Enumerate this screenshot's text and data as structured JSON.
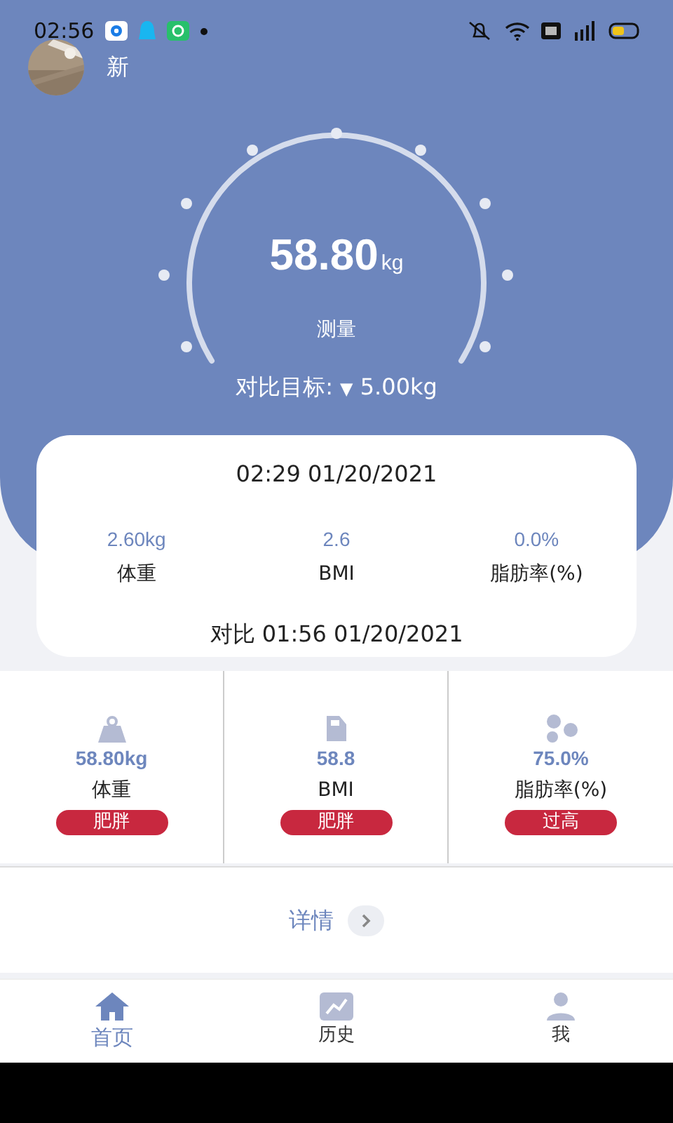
{
  "status_bar": {
    "time": "02:56"
  },
  "profile": {
    "name": "新"
  },
  "gauge": {
    "value": "58.80",
    "unit": "kg",
    "action": "测量"
  },
  "target": {
    "label": "对比目标:",
    "arrow": "▼",
    "value": "5.00kg"
  },
  "comparison": {
    "time": "02:29 01/20/2021",
    "metrics": [
      {
        "value": "2.60kg",
        "label": "体重"
      },
      {
        "value": "2.6",
        "label": "BMI"
      },
      {
        "value": "0.0%",
        "label": "脂肪率(%)"
      }
    ],
    "footer": "对比 01:56 01/20/2021"
  },
  "metrics": [
    {
      "kind": "weight",
      "value": "58.80kg",
      "label": "体重",
      "status": "肥胖"
    },
    {
      "kind": "bmi",
      "value": "58.8",
      "label": "BMI",
      "status": "肥胖"
    },
    {
      "kind": "fat",
      "value": "75.0%",
      "label": "脂肪率(%)",
      "status": "过高"
    }
  ],
  "details": {
    "label": "详情"
  },
  "nav": [
    {
      "kind": "home",
      "label": "首页",
      "selected": true
    },
    {
      "kind": "history",
      "label": "历史",
      "selected": false
    },
    {
      "kind": "me",
      "label": "我",
      "selected": false
    }
  ]
}
